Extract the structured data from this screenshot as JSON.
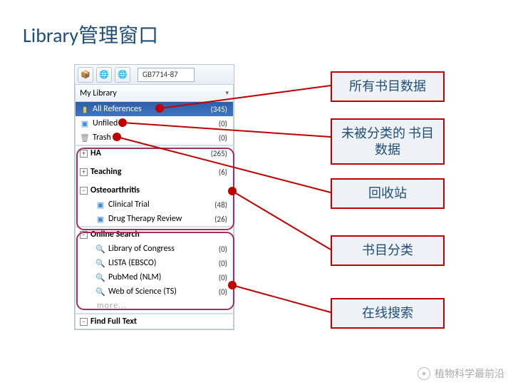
{
  "title": "Library管理窗口",
  "toolbar": {
    "style_label": "GB7714-87"
  },
  "lib_header": "My Library",
  "rows": {
    "all_refs": {
      "label": "All References",
      "count": "(345)"
    },
    "unfiled": {
      "label": "Unfiled",
      "count": "(0)"
    },
    "trash": {
      "label": "Trash",
      "count": "(0)"
    },
    "ha": {
      "label": "HA",
      "count": "(265)"
    },
    "teaching": {
      "label": "Teaching",
      "count": "(6)"
    },
    "osteo": {
      "label": "Osteoarthritis",
      "count": ""
    },
    "ct": {
      "label": "Clinical Trial",
      "count": "(48)"
    },
    "dtr": {
      "label": "Drug Therapy Review",
      "count": "(26)"
    },
    "online": {
      "label": "Online Search",
      "count": ""
    },
    "loc": {
      "label": "Library of Congress",
      "count": "(0)"
    },
    "lista": {
      "label": "LISTA (EBSCO)",
      "count": "(0)"
    },
    "pubmed": {
      "label": "PubMed (NLM)",
      "count": "(0)"
    },
    "wos": {
      "label": "Web of Science (TS)",
      "count": "(0)"
    },
    "more": {
      "label": "more..."
    },
    "fft": {
      "label": "Find Full Text"
    }
  },
  "labels": {
    "l1": "所有书目数据",
    "l2": "未被分类的\n书目数据",
    "l3": "回收站",
    "l4": "书目分类",
    "l5": "在线搜索"
  },
  "watermark": "植物科学最前沿"
}
